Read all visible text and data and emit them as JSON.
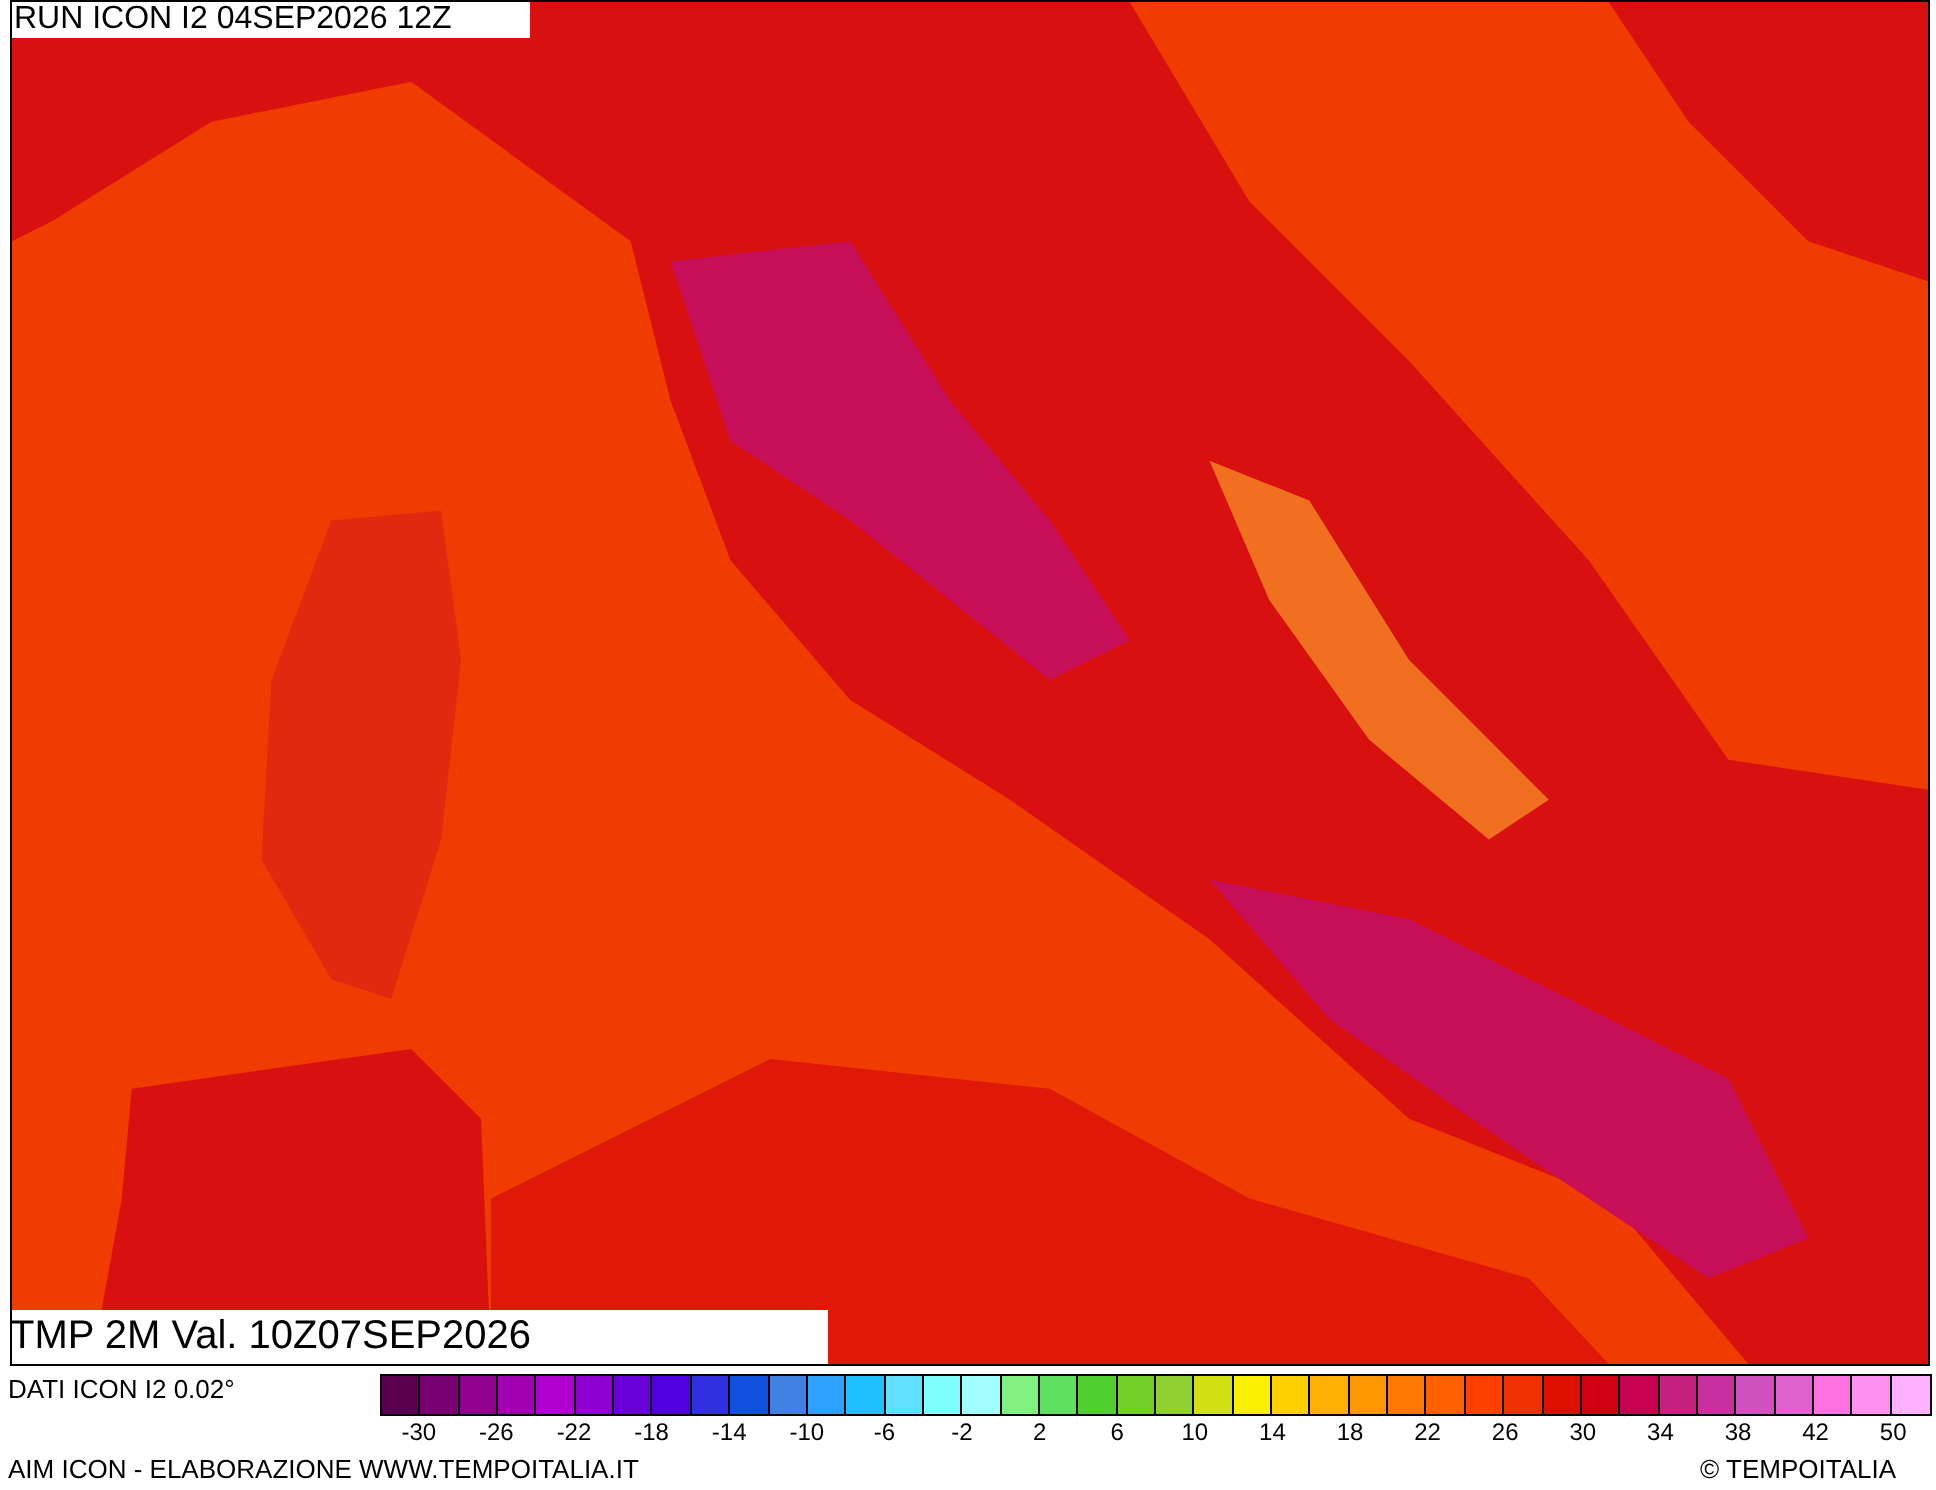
{
  "header": {
    "run_label": "RUN ICON I2 04SEP2026 12Z"
  },
  "map": {
    "title": "TMP 2M Val. 10Z07SEP2026"
  },
  "legend": {
    "source": "DATI ICON I2 0.02°",
    "bins": [
      {
        "color": "#5a0050"
      },
      {
        "color": "#780070"
      },
      {
        "color": "#900090"
      },
      {
        "color": "#a000b0"
      },
      {
        "color": "#b000d0"
      },
      {
        "color": "#9000d0"
      },
      {
        "color": "#6a00d8"
      },
      {
        "color": "#5000e0"
      },
      {
        "color": "#3030e0"
      },
      {
        "color": "#1050e0"
      },
      {
        "color": "#4080e0"
      },
      {
        "color": "#30a0ff"
      },
      {
        "color": "#20c0ff"
      },
      {
        "color": "#60e0ff"
      },
      {
        "color": "#80ffff"
      },
      {
        "color": "#a0ffff"
      },
      {
        "color": "#80f080"
      },
      {
        "color": "#60e060"
      },
      {
        "color": "#50d030"
      },
      {
        "color": "#70d028"
      },
      {
        "color": "#90d030"
      },
      {
        "color": "#d0e010"
      },
      {
        "color": "#f8f000"
      },
      {
        "color": "#ffd000"
      },
      {
        "color": "#ffb000"
      },
      {
        "color": "#ff9800"
      },
      {
        "color": "#ff7800"
      },
      {
        "color": "#ff6000"
      },
      {
        "color": "#ff4000"
      },
      {
        "color": "#f03000"
      },
      {
        "color": "#e01000"
      },
      {
        "color": "#d00010"
      },
      {
        "color": "#c80050"
      },
      {
        "color": "#c82080"
      },
      {
        "color": "#c830a0"
      },
      {
        "color": "#d050c0"
      },
      {
        "color": "#e060d0"
      },
      {
        "color": "#ff70e0"
      },
      {
        "color": "#ff90f0"
      },
      {
        "color": "#ffb0ff"
      }
    ],
    "ticks": [
      "-30",
      "-26",
      "-22",
      "-18",
      "-14",
      "-10",
      "-6",
      "-2",
      "2",
      "6",
      "10",
      "14",
      "18",
      "22",
      "26",
      "30",
      "34",
      "38",
      "42",
      "50"
    ]
  },
  "footer": {
    "credit": "AIM ICON - ELABORAZIONE WWW.TEMPOITALIA.IT",
    "copyright": "© TEMPOITALIA"
  }
}
